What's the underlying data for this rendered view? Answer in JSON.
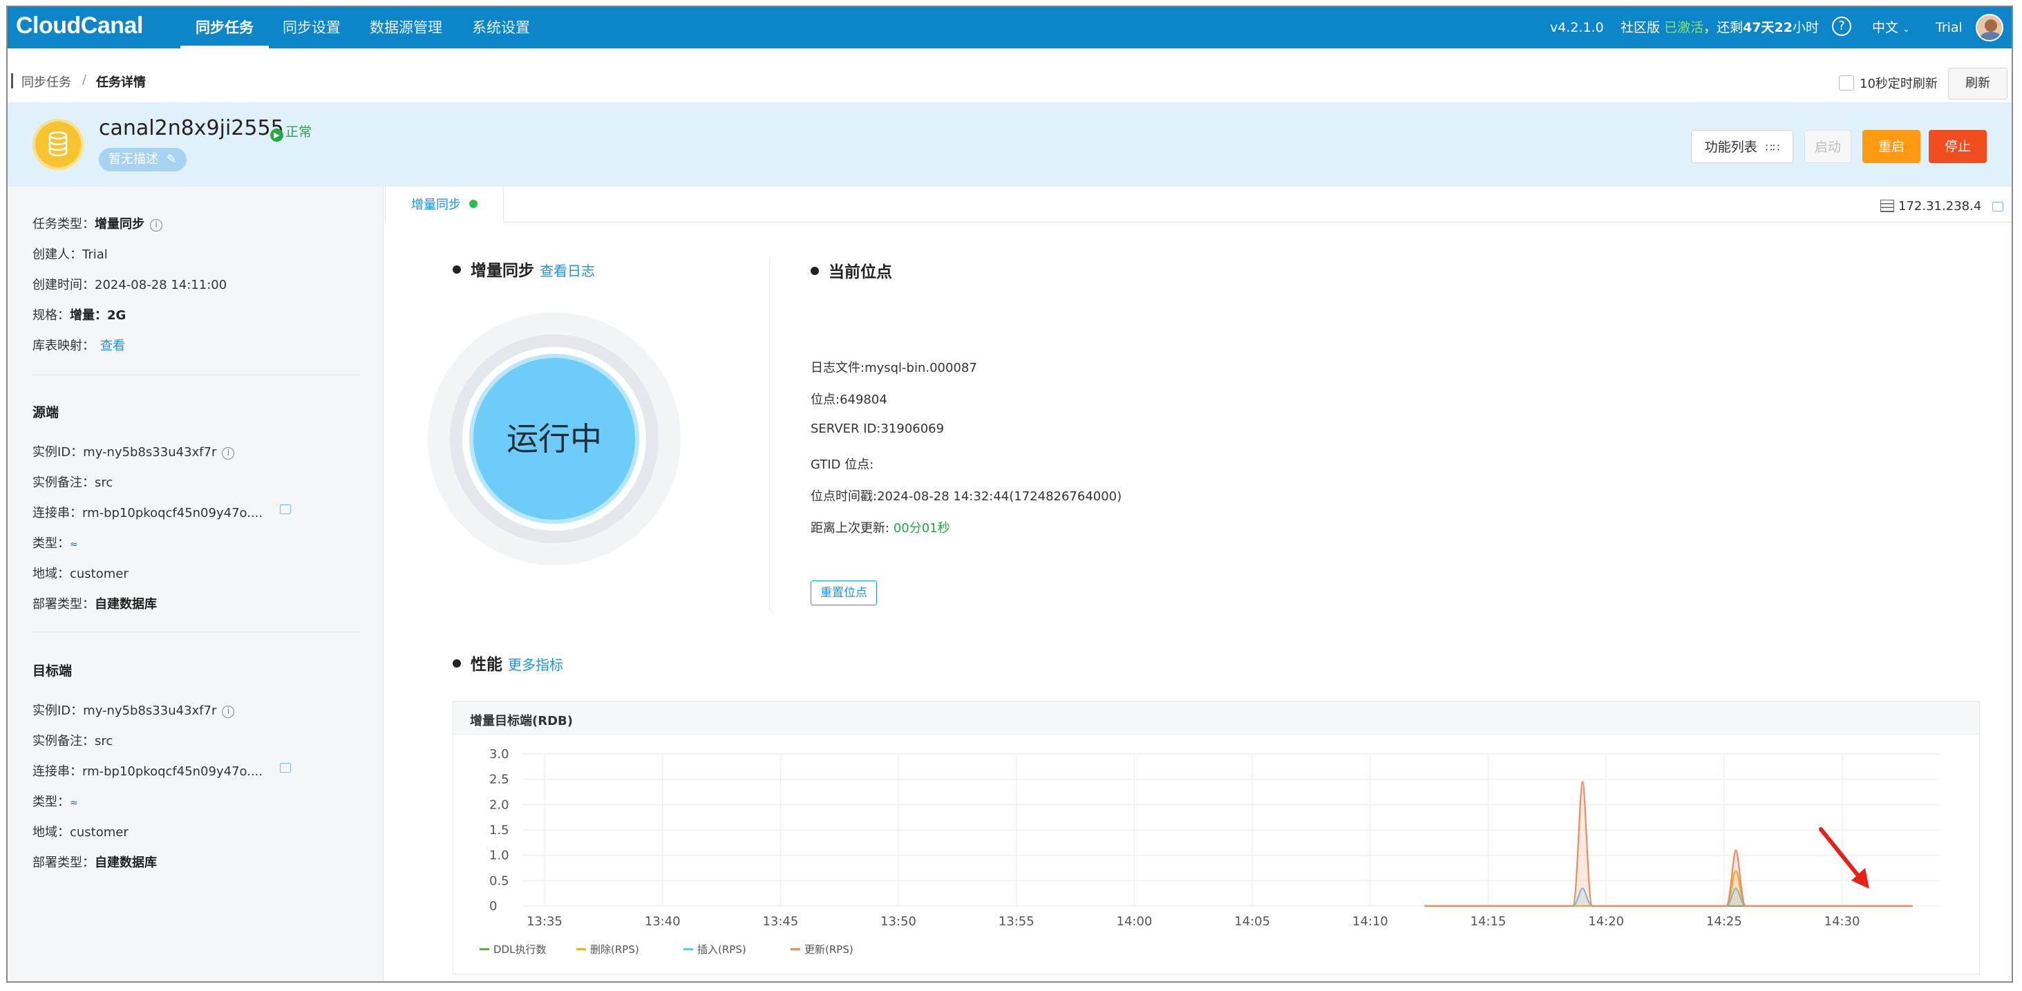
{
  "nav": {
    "logo": "CloudCanal",
    "items": [
      "同步任务",
      "同步设置",
      "数据源管理",
      "系统设置"
    ],
    "version": "v4.2.1.0",
    "edition": "社区版",
    "activated": "已激活",
    "remaining_prefix": "，还剩",
    "remaining_days": "47天22",
    "remaining_suffix": "小时",
    "help": "?",
    "language": "中文",
    "user": "Trial"
  },
  "breadcrumb": {
    "parent": "同步任务",
    "sep": "/",
    "current": "任务详情"
  },
  "auto_refresh": {
    "label": "10秒定时刷新",
    "checked": false
  },
  "refresh_label": "刷新",
  "task": {
    "name": "canal2n8x9ji2555",
    "status": "正常",
    "description": "暂无描述",
    "buttons": {
      "func_list": "功能列表",
      "start": "启动",
      "restart": "重启",
      "stop": "停止"
    }
  },
  "left": {
    "task_type_label": "任务类型：",
    "task_type": "增量同步",
    "creator_label": "创建人：",
    "creator": "Trial",
    "created_label": "创建时间：",
    "created": "2024-08-28 14:11:00",
    "spec_label": "规格：",
    "spec": "增量：2G",
    "mapping_label": "库表映射：",
    "mapping_link": "查看",
    "source": {
      "title": "源端",
      "instance_label": "实例ID：",
      "instance": "my-ny5b8s33u43xf7r",
      "remark_label": "实例备注：",
      "remark": "src",
      "conn_label": "连接串：",
      "conn": "rm-bp10pkoqcf45n09y47o....",
      "type_label": "类型：",
      "region_label": "地域：",
      "region": "customer",
      "deploy_label": "部署类型：",
      "deploy": "自建数据库"
    },
    "target": {
      "title": "目标端",
      "instance_label": "实例ID：",
      "instance": "my-ny5b8s33u43xf7r",
      "remark_label": "实例备注：",
      "remark": "src",
      "conn_label": "连接串：",
      "conn": "rm-bp10pkoqcf45n09y47o....",
      "type_label": "类型：",
      "region_label": "地域：",
      "region": "customer",
      "deploy_label": "部署类型：",
      "deploy": "自建数据库"
    }
  },
  "main": {
    "tab": "增量同步",
    "ip": "172.31.238.4",
    "sync_title": "增量同步",
    "sync_log_link": "查看日志",
    "running": "运行中",
    "position_title": "当前位点",
    "log_file": "日志文件:mysql-bin.000087",
    "position": "位点:649804",
    "server_id": "SERVER ID:31906069",
    "gtid": "GTID 位点:",
    "position_time": "位点时间戳:2024-08-28 14:32:44(1724826764000)",
    "last_update_label": "距离上次更新:",
    "last_update": "00分01秒",
    "reset_label": "重置位点",
    "perf_title": "性能",
    "perf_link": "更多指标"
  },
  "chart_data": {
    "type": "area",
    "title": "增量目标端(RDB)",
    "ylim": [
      0,
      3.0
    ],
    "yticks": [
      "3.0",
      "2.5",
      "2.0",
      "1.5",
      "1.0",
      "0.5",
      "0"
    ],
    "xticks": [
      "13:35",
      "13:40",
      "13:45",
      "13:50",
      "13:55",
      "14:00",
      "14:05",
      "14:10",
      "14:15",
      "14:20",
      "14:25",
      "14:30"
    ],
    "x_minutes": [
      0,
      5,
      10,
      15,
      20,
      25,
      30,
      35,
      40,
      45,
      50,
      55
    ],
    "data_start_minute": 37.3,
    "x_max_minute": 58.0,
    "series": [
      {
        "name": "DDL执行数",
        "color": "#6aa84f",
        "peaks": []
      },
      {
        "name": "删除(RPS)",
        "color": "#e6b422",
        "peaks": [
          {
            "x": 50.5,
            "y": 0.7
          }
        ]
      },
      {
        "name": "插入(RPS)",
        "color": "#68c6e8",
        "peaks": [
          {
            "x": 44.0,
            "y": 0.35
          },
          {
            "x": 50.5,
            "y": 0.35
          }
        ]
      },
      {
        "name": "更新(RPS)",
        "color": "#f08a5d",
        "peaks": [
          {
            "x": 44.0,
            "y": 2.45
          },
          {
            "x": 50.5,
            "y": 1.1
          }
        ]
      }
    ]
  }
}
